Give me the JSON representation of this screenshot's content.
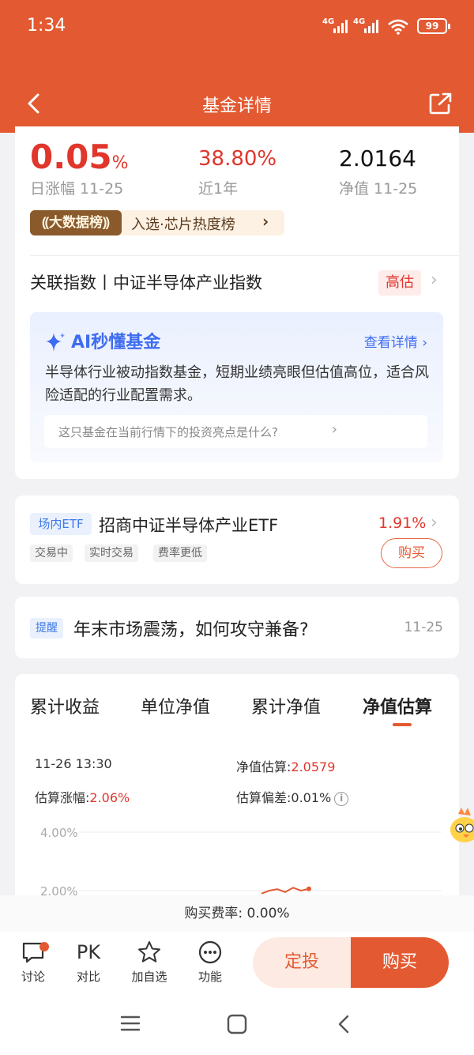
{
  "status_bar": {
    "time": "1:34",
    "signal1": "4G",
    "signal2": "4G",
    "battery": "99"
  },
  "header": {
    "title": "基金详情"
  },
  "stats": {
    "daily_change_num": "0.05",
    "daily_change_unit": "%",
    "daily_change_label": "日涨幅 11-25",
    "year_change": "38.80%",
    "year_change_label": "近1年",
    "nav": "2.0164",
    "nav_label": "净值 11-25"
  },
  "rank": {
    "tag": "大数据榜",
    "text": "入选·芯片热度榜"
  },
  "index": {
    "text": "关联指数丨中证半导体产业指数",
    "badge": "高估"
  },
  "ai": {
    "title": "AI秒懂基金",
    "more": "查看详情",
    "desc": "半导体行业被动指数基金，短期业绩亮眼但估值高位，适合风险适配的行业配置需求。",
    "question": "这只基金在当前行情下的投资亮点是什么?"
  },
  "etf": {
    "tag": "场内ETF",
    "name": "招商中证半导体产业ETF",
    "change": "1.91%",
    "tags": [
      "交易中",
      "实时交易",
      "费率更低"
    ],
    "buy": "购买"
  },
  "reminder": {
    "tag": "提醒",
    "text": "年末市场震荡，如何攻守兼备?",
    "date": "11-25"
  },
  "chart_tabs": [
    "累计收益",
    "单位净值",
    "累计净值",
    "净值估算"
  ],
  "estimate": {
    "time": "11-26 13:30",
    "nav_label": "净值估算:",
    "nav_value": "2.0579",
    "change_label": "估算涨幅:",
    "change_value": "2.06%",
    "dev_label": "估算偏差:",
    "dev_value": "0.01%"
  },
  "chart_data": {
    "type": "line",
    "y_ticks": [
      "4.00%",
      "2.00%"
    ],
    "series": [
      {
        "values": [
          1.9,
          2.0,
          2.05,
          1.95,
          2.1,
          2.0,
          2.06
        ]
      }
    ]
  },
  "buy_rate": "购买费率: 0.00%",
  "bottom_bar": {
    "discuss": "讨论",
    "pk_icon": "PK",
    "compare": "对比",
    "favorite": "加自选",
    "functions": "功能",
    "dingtou": "定投",
    "buy": "购买"
  },
  "colors": {
    "brand": "#e35a32",
    "up": "#e0362c",
    "ai_blue": "#3e6cf0"
  }
}
